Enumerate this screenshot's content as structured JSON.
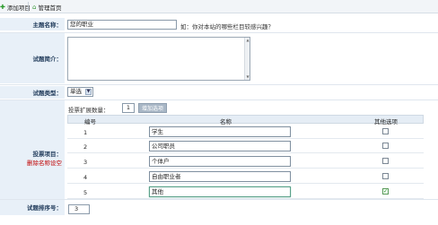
{
  "toolbar": {
    "add_label": "添加项目",
    "manage_label": "管理首页"
  },
  "form": {
    "title_label": "主题名称：",
    "title_value": "您的职业",
    "title_hint": "如：你对本站的哪些栏目较感兴趣？",
    "intro_label": "试题简介：",
    "intro_value": "",
    "type_label": "试题类型：",
    "type_value": "单选",
    "vote_label": "投票项目：",
    "vote_sub": "删除名称设空",
    "expand_label": "投票扩展数量：",
    "expand_value": "1",
    "add_option_button": "增加选项",
    "sort_label": "试题排序号：",
    "sort_value": "3"
  },
  "grid": {
    "headers": [
      "编号",
      "名称",
      "其他选项"
    ],
    "rows": [
      {
        "num": "1",
        "name": "学生",
        "other": false
      },
      {
        "num": "2",
        "name": "公司职员",
        "other": false
      },
      {
        "num": "3",
        "name": "个体户",
        "other": false
      },
      {
        "num": "4",
        "name": "自由职业者",
        "other": false
      },
      {
        "num": "5",
        "name": "其他",
        "other": true
      }
    ]
  }
}
